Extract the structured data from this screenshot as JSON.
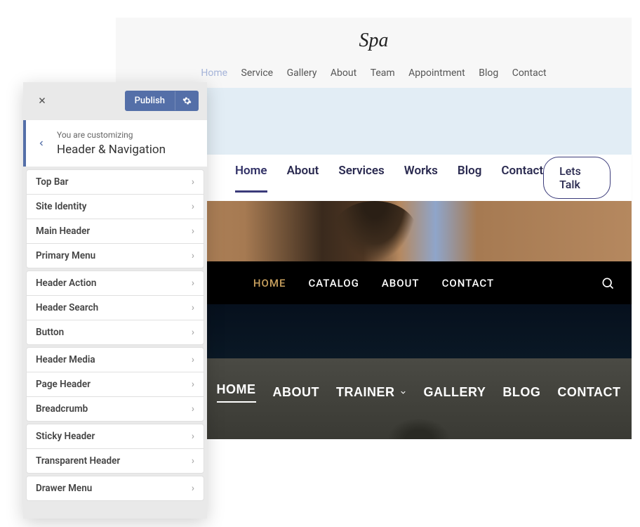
{
  "spa": {
    "logo": "Spa",
    "nav": [
      "Home",
      "Service",
      "Gallery",
      "About",
      "Team",
      "Appointment",
      "Blog",
      "Contact"
    ],
    "active": 0
  },
  "nav2": {
    "items": [
      "Home",
      "About",
      "Services",
      "Works",
      "Blog",
      "Contact"
    ],
    "active": 0,
    "cta": "Lets Talk"
  },
  "nav3": {
    "items": [
      "HOME",
      "CATALOG",
      "ABOUT",
      "CONTACT"
    ],
    "active": 0
  },
  "nav4": {
    "items": [
      "HOME",
      "ABOUT",
      "TRAINER",
      "GALLERY",
      "BLOG",
      "CONTACT"
    ],
    "active": 0,
    "dropdown_index": 2
  },
  "customizer": {
    "publish": "Publish",
    "subtitle": "You are customizing",
    "title": "Header & Navigation",
    "groups": [
      [
        "Top Bar",
        "Site Identity",
        "Main Header",
        "Primary Menu"
      ],
      [
        "Header Action",
        "Header Search",
        "Button"
      ],
      [
        "Header Media",
        "Page Header",
        "Breadcrumb"
      ],
      [
        "Sticky Header",
        "Transparent Header"
      ],
      [
        "Drawer Menu"
      ]
    ]
  }
}
